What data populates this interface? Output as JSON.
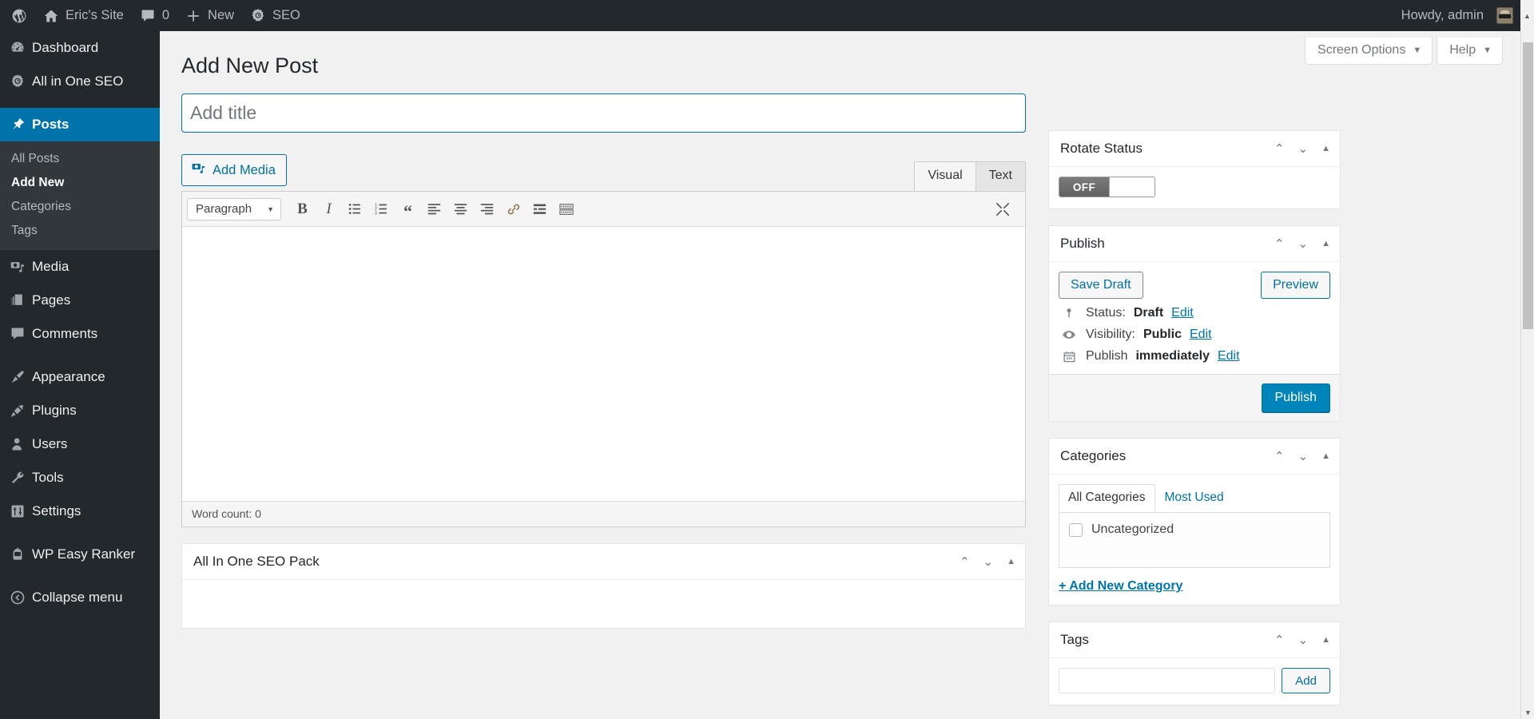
{
  "adminbar": {
    "wp_logo_icon": "wordpress-logo-icon",
    "site_icon": "home-icon",
    "site_name": "Eric's Site",
    "comments_icon": "comment-bubble-icon",
    "comments_count": "0",
    "new_icon": "plus-icon",
    "new_label": "New",
    "seo_icon": "seo-gear-icon",
    "seo_label": "SEO",
    "howdy": "Howdy, admin",
    "avatar": "user-avatar"
  },
  "sidebar": {
    "items": [
      {
        "label": "Dashboard",
        "icon": "dashboard-icon",
        "current": false,
        "sep_before": false
      },
      {
        "label": "All in One SEO",
        "icon": "aioseo-gear-icon",
        "current": false,
        "sep_before": false
      },
      {
        "label": "Posts",
        "icon": "pin-icon",
        "current": true,
        "sep_before": true
      },
      {
        "label": "Media",
        "icon": "media-icon",
        "current": false,
        "sep_before": false
      },
      {
        "label": "Pages",
        "icon": "pages-icon",
        "current": false,
        "sep_before": false
      },
      {
        "label": "Comments",
        "icon": "comment-bubble-icon",
        "current": false,
        "sep_before": false
      },
      {
        "label": "Appearance",
        "icon": "paintbrush-icon",
        "current": false,
        "sep_before": true
      },
      {
        "label": "Plugins",
        "icon": "plug-icon",
        "current": false,
        "sep_before": false
      },
      {
        "label": "Users",
        "icon": "user-icon",
        "current": false,
        "sep_before": false
      },
      {
        "label": "Tools",
        "icon": "wrench-icon",
        "current": false,
        "sep_before": false
      },
      {
        "label": "Settings",
        "icon": "sliders-icon",
        "current": false,
        "sep_before": false
      },
      {
        "label": "WP Easy Ranker",
        "icon": "robot-icon",
        "current": false,
        "sep_before": true
      },
      {
        "label": "Collapse menu",
        "icon": "collapse-arrow-icon",
        "current": false,
        "sep_before": true
      }
    ],
    "posts_submenu": [
      {
        "label": "All Posts",
        "current": false
      },
      {
        "label": "Add New",
        "current": true
      },
      {
        "label": "Categories",
        "current": false
      },
      {
        "label": "Tags",
        "current": false
      }
    ]
  },
  "screen_meta": {
    "screen_options": "Screen Options",
    "help": "Help",
    "caret": "▼"
  },
  "page": {
    "title": "Add New Post"
  },
  "title_field": {
    "value": "",
    "placeholder": "Add title"
  },
  "editor": {
    "add_media_label": "Add Media",
    "add_media_icon": "media-camera-note-icon",
    "tabs": [
      {
        "label": "Visual",
        "active": true
      },
      {
        "label": "Text",
        "active": false
      }
    ],
    "format_select": "Paragraph",
    "format_caret": "▼",
    "toolbar_buttons": [
      {
        "name": "bold-icon",
        "glyph": "B"
      },
      {
        "name": "italic-icon",
        "glyph": "I"
      },
      {
        "name": "bulleted-list-icon",
        "glyph": ""
      },
      {
        "name": "numbered-list-icon",
        "glyph": ""
      },
      {
        "name": "blockquote-icon",
        "glyph": "“"
      },
      {
        "name": "align-left-icon",
        "glyph": ""
      },
      {
        "name": "align-center-icon",
        "glyph": ""
      },
      {
        "name": "align-right-icon",
        "glyph": ""
      },
      {
        "name": "insert-link-icon",
        "glyph": ""
      },
      {
        "name": "read-more-icon",
        "glyph": ""
      },
      {
        "name": "toolbar-toggle-icon",
        "glyph": ""
      }
    ],
    "fullscreen_icon": "distraction-free-icon",
    "content": "",
    "word_count": "Word count: 0"
  },
  "aioseo_box": {
    "title": "All In One SEO Pack",
    "actions": {
      "up": "⌃",
      "down": "⌄",
      "toggle": "▲"
    }
  },
  "boxes": {
    "rotate_status": {
      "title": "Rotate Status",
      "toggle_label": "OFF",
      "toggle_state": "off"
    },
    "publish": {
      "title": "Publish",
      "save_draft": "Save Draft",
      "preview": "Preview",
      "status_icon": "pin-marker-icon",
      "status_label": "Status:",
      "status_value": "Draft",
      "status_edit": "Edit",
      "visibility_icon": "eye-icon",
      "visibility_label": "Visibility:",
      "visibility_value": "Public",
      "visibility_edit": "Edit",
      "schedule_icon": "calendar-icon",
      "schedule_label": "Publish",
      "schedule_value": "immediately",
      "schedule_edit": "Edit",
      "publish_button": "Publish"
    },
    "categories": {
      "title": "Categories",
      "tabs": [
        {
          "label": "All Categories",
          "active": true
        },
        {
          "label": "Most Used",
          "active": false
        }
      ],
      "items": [
        {
          "label": "Uncategorized",
          "checked": false
        }
      ],
      "add_new": "+ Add New Category"
    },
    "tags": {
      "title": "Tags",
      "input_value": "",
      "add_button": "Add"
    },
    "actions": {
      "up": "⌃",
      "down": "⌄",
      "toggle": "▲"
    }
  },
  "colors": {
    "admin_bg": "#23282d",
    "submenu_bg": "#32373c",
    "accent": "#0073aa",
    "primary_button": "#0085ba",
    "link": "#0073aa",
    "page_bg": "#f1f1f1"
  }
}
